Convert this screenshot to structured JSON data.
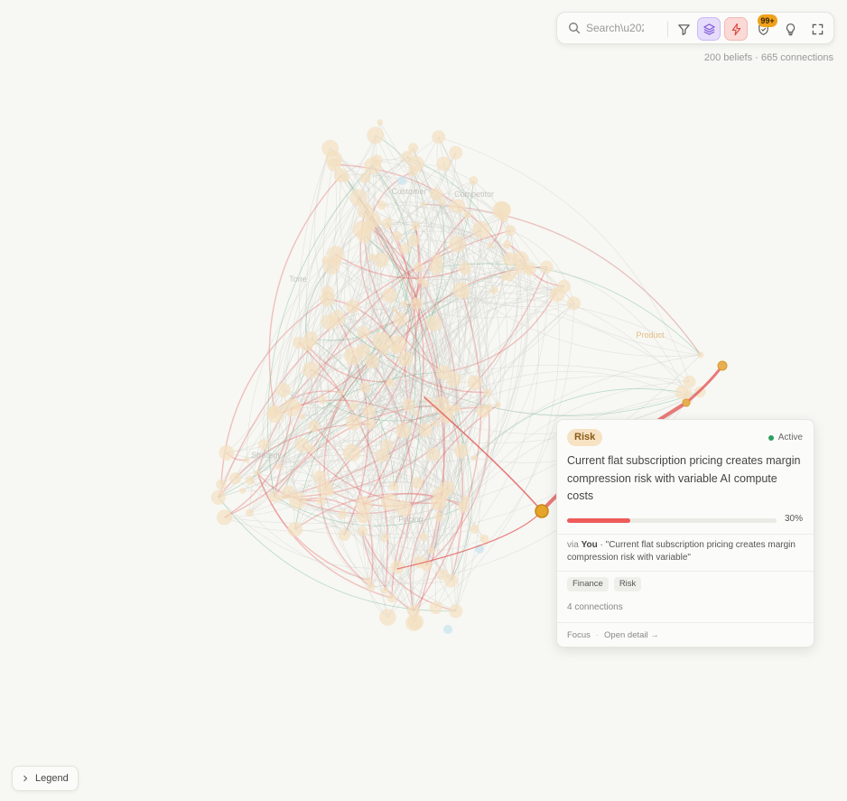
{
  "toolbar": {
    "search_placeholder": "Search\\u2026",
    "badge_count": "99+",
    "icons": [
      "search-icon",
      "filter-icon",
      "layers-icon",
      "bolt-icon",
      "shield-icon",
      "bulb-icon",
      "expand-icon"
    ],
    "colors": {
      "layers_active": "#e6dcfb",
      "bolt_active": "#fbd9d6",
      "badge": "#f0a21b"
    }
  },
  "stats": "200 beliefs · 665 connections",
  "graph": {
    "cluster_labels": [
      "Tone",
      "Pricing",
      "Customer",
      "Competitor",
      "Strategy",
      "Product"
    ],
    "colors": {
      "node": "#f4dfc0",
      "selected_node": "#e6a52a",
      "risk_edge": "#e25a5a",
      "support_edge": "#2e9f62",
      "edge": "#cfcfca"
    }
  },
  "detail": {
    "category": "Risk",
    "status": "Active",
    "text": "Current flat subscription pricing creates margin compression risk with variable AI compute costs",
    "confidence": 30,
    "confidence_label": "30%",
    "via_prefix": "via",
    "via_by": "You",
    "via_quote": "\"Current flat subscription pricing creates margin compression risk with variable\"",
    "tags": [
      "Finance",
      "Risk"
    ],
    "connections": "4 connections",
    "actions": {
      "focus": "Focus",
      "open_detail": "Open detail →"
    },
    "colors": {
      "category_bg": "#f7e2c4",
      "status": "#2e9f62",
      "progress": "#ef5b5b"
    }
  },
  "legend": {
    "label": "Legend"
  }
}
